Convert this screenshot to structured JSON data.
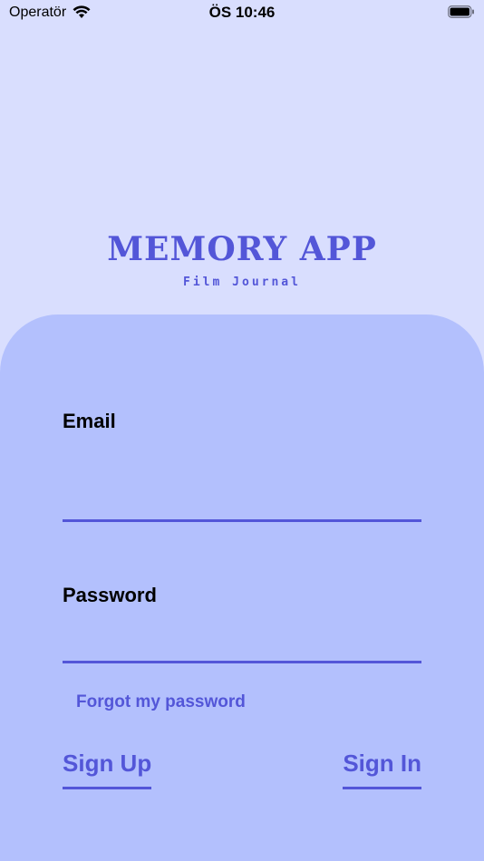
{
  "status_bar": {
    "carrier": "Operatör",
    "time": "ÖS 10:46",
    "wifi_icon": "wifi-icon",
    "battery_icon": "battery-icon"
  },
  "brand": {
    "title": "MEMORY APP",
    "subtitle": "Film Journal"
  },
  "form": {
    "email_label": "Email",
    "email_value": "",
    "password_label": "Password",
    "password_value": "",
    "forgot_label": "Forgot my password",
    "sign_up_label": "Sign Up",
    "sign_in_label": "Sign In"
  },
  "colors": {
    "background": "#d9defe",
    "card": "#b3c0fd",
    "accent": "#5356d8"
  }
}
